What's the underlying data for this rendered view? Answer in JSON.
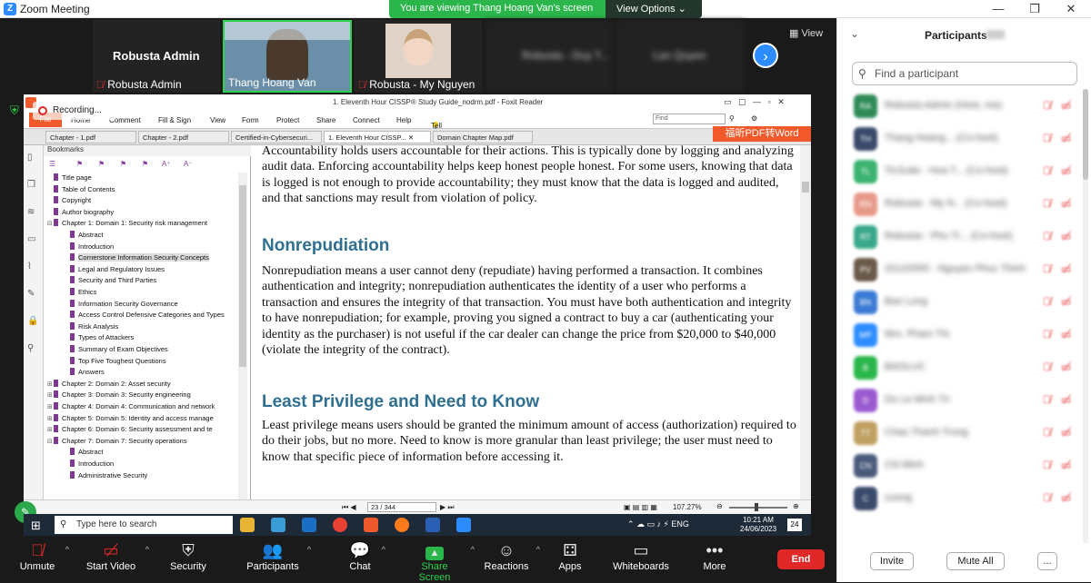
{
  "window": {
    "title": "Zoom Meeting",
    "app_logo": "Z"
  },
  "share_banner": {
    "text": "You are viewing Thang Hoang Van's screen",
    "view_options": "View Options"
  },
  "video_strip": {
    "tiles": [
      {
        "name": "Robusta Admin",
        "label": "Robusta Admin"
      },
      {
        "name": "Thang Hoang Van"
      },
      {
        "name": "Robusta - My Nguyen"
      },
      {
        "name": "Robusta - Duy T..."
      },
      {
        "name": "Lan Quyen"
      }
    ],
    "view_label": "View"
  },
  "recording": {
    "label": "Recording..."
  },
  "foxit": {
    "title": "1. Eleventh Hour CISSP® Study Guide_nodrm.pdf - Foxit Reader",
    "file_label": "File",
    "menu": [
      "Home",
      "Comment",
      "Fill & Sign",
      "View",
      "Form",
      "Protect",
      "Share",
      "Connect",
      "Help"
    ],
    "tell_me": "Tell me what you want to do...",
    "find_placeholder": "Find",
    "tabs": [
      "Chapter - 1.pdf",
      "Chapter - 2.pdf",
      "Certified-in-Cybersecuri...",
      "1. Eleventh Hour CISSP...",
      "Domain Chapter Map.pdf"
    ],
    "word_badge": "福昕PDF转Word",
    "bookmarks_title": "Bookmarks",
    "bookmarks": [
      {
        "text": "Title page",
        "level": 0,
        "exp": ""
      },
      {
        "text": "Table of Contents",
        "level": 0,
        "exp": ""
      },
      {
        "text": "Copyright",
        "level": 0,
        "exp": ""
      },
      {
        "text": "Author biography",
        "level": 0,
        "exp": ""
      },
      {
        "text": "Chapter 1: Domain 1: Security risk management",
        "level": 0,
        "exp": "⊟"
      },
      {
        "text": "Abstract",
        "level": 1,
        "exp": ""
      },
      {
        "text": "Introduction",
        "level": 1,
        "exp": ""
      },
      {
        "text": "Cornerstone Information Security Concepts",
        "level": 1,
        "exp": "",
        "selected": true
      },
      {
        "text": "Legal and Regulatory Issues",
        "level": 1,
        "exp": ""
      },
      {
        "text": "Security and Third Parties",
        "level": 1,
        "exp": ""
      },
      {
        "text": "Ethics",
        "level": 1,
        "exp": ""
      },
      {
        "text": "Information Security Governance",
        "level": 1,
        "exp": ""
      },
      {
        "text": "Access Control Defensive Categories and Types",
        "level": 1,
        "exp": ""
      },
      {
        "text": "Risk Analysis",
        "level": 1,
        "exp": ""
      },
      {
        "text": "Types of Attackers",
        "level": 1,
        "exp": ""
      },
      {
        "text": "Summary of Exam Objectives",
        "level": 1,
        "exp": ""
      },
      {
        "text": "Top Five Toughest Questions",
        "level": 1,
        "exp": ""
      },
      {
        "text": "Answers",
        "level": 1,
        "exp": ""
      },
      {
        "text": "Chapter 2: Domain 2: Asset security",
        "level": 0,
        "exp": "⊞"
      },
      {
        "text": "Chapter 3: Domain 3: Security engineering",
        "level": 0,
        "exp": "⊞"
      },
      {
        "text": "Chapter 4: Domain 4: Communication and network",
        "level": 0,
        "exp": "⊞"
      },
      {
        "text": "Chapter 5: Domain 5: Identity and access manage",
        "level": 0,
        "exp": "⊞"
      },
      {
        "text": "Chapter 6: Domain 6: Security assessment and te",
        "level": 0,
        "exp": "⊞"
      },
      {
        "text": "Chapter 7: Domain 7: Security operations",
        "level": 0,
        "exp": "⊟"
      },
      {
        "text": "Abstract",
        "level": 1,
        "exp": ""
      },
      {
        "text": "Introduction",
        "level": 1,
        "exp": ""
      },
      {
        "text": "Administrative Security",
        "level": 1,
        "exp": ""
      }
    ],
    "doc": {
      "p1": "Accountability holds users accountable for their actions. This is typically done by logging and analyzing audit data. Enforcing accountability helps keep honest people honest. For some users, knowing that data is logged is not enough to provide accountability; they must know that the data is logged and audited, and that sanctions may result from violation of policy.",
      "h_nonrep": "Nonrepudiation",
      "p2": "Nonrepudiation means a user cannot deny (repudiate) having performed a transaction. It combines authentication and integrity; nonrepudiation authenticates the identity of a user who performs a transaction and ensures the integrity of that transaction. You must have both authentication and integrity to have nonrepudiation; for example, proving you signed a contract to buy a car (authenticating your identity as the purchaser) is not useful if the car dealer can change the price from $20,000 to $40,000 (violate the integrity of the contract).",
      "h_least": "Least Privilege and Need to Know",
      "p3": "Least privilege means users should be granted the minimum amount of access (authorization) required to do their jobs, but no more. Need to know is more granular than least privilege; the user must need to know that specific piece of information before accessing it."
    },
    "status": {
      "page": "23 / 344",
      "zoom": "107.27%"
    }
  },
  "taskbar": {
    "search_placeholder": "Type here to search",
    "time": "10:21 AM",
    "date": "24/06/2023",
    "notif": "24"
  },
  "toolbar": {
    "unmute": "Unmute",
    "start_video": "Start Video",
    "security": "Security",
    "participants": "Participants",
    "chat": "Chat",
    "share_screen": "Share Screen",
    "reactions": "Reactions",
    "apps": "Apps",
    "whiteboards": "Whiteboards",
    "more": "More",
    "end": "End"
  },
  "panel": {
    "title": "Participants",
    "find_placeholder": "Find a participant",
    "participants": [
      {
        "initials": "RA",
        "color": "#2e8b57",
        "name": "Robusta Admin (Host, me)"
      },
      {
        "initials": "TH",
        "color": "#3a4a6b",
        "name": "Thang Hoang... (Co-host)"
      },
      {
        "initials": "TL",
        "color": "#3cb371",
        "name": "TicSuite - Hoa T... (Co-host)"
      },
      {
        "initials": "RN",
        "color": "#e89a8a",
        "name": "Robusta - My N... (Co-host)"
      },
      {
        "initials": "RT",
        "color": "#3aa88a",
        "name": "Robusta - Phu Tr... (Co-host)"
      },
      {
        "initials": "PV",
        "color": "#6b5a4a",
        "name": "20120555 - Nguyen Phuc Thinh"
      },
      {
        "initials": "BN",
        "color": "#3a7bd5",
        "name": "Bao Long"
      },
      {
        "initials": "MP",
        "color": "#2d8cff",
        "name": "Mrs. Pham Thi"
      },
      {
        "initials": "B",
        "color": "#2bb64b",
        "name": "BAOLUC"
      },
      {
        "initials": "D",
        "color": "#9a5ad0",
        "name": "Do Le Minh Tri"
      },
      {
        "initials": "TT",
        "color": "#c0a060",
        "name": "Chau Thanh Trung"
      },
      {
        "initials": "CN",
        "color": "#4a5a7b",
        "name": "CN Minh"
      },
      {
        "initials": "C",
        "color": "#3a4a6b",
        "name": "cuong"
      }
    ],
    "invite": "Invite",
    "mute_all": "Mute All",
    "more": "..."
  }
}
